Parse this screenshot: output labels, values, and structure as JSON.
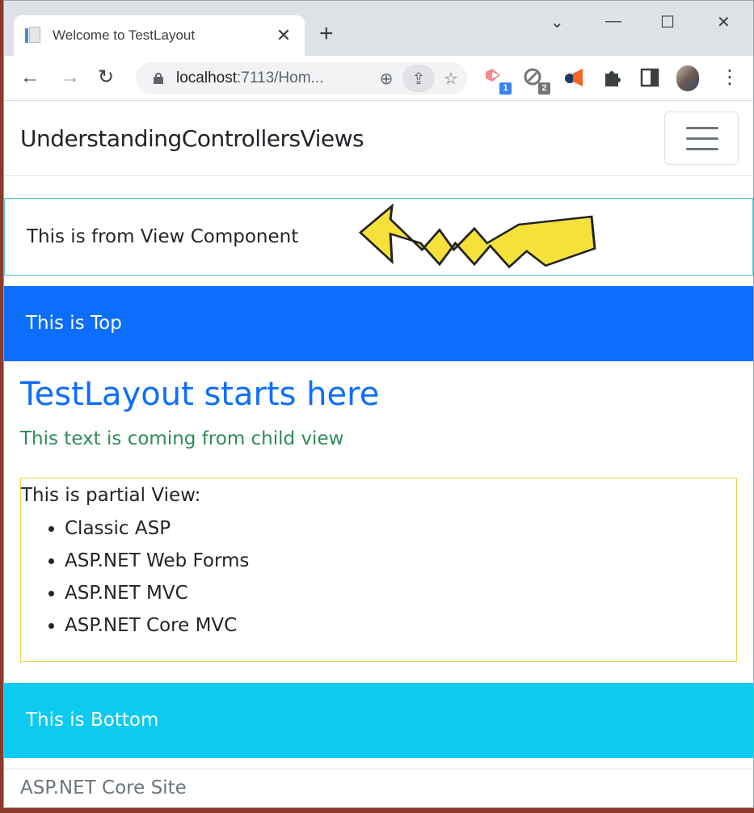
{
  "browser": {
    "tab": {
      "title": "Welcome to TestLayout",
      "close_glyph": "✕",
      "favicon": "document-icon"
    },
    "new_tab_glyph": "+",
    "window_controls": {
      "tab_search": "⌄",
      "minimize": "—",
      "maximize": "☐",
      "close": "✕"
    },
    "nav": {
      "back": "←",
      "forward": "→",
      "reload": "↻"
    },
    "address": {
      "host": "localhost",
      "rest": ":7113/Hom..."
    },
    "omnibox_icons": {
      "zoom": "⊕",
      "share": "⇪",
      "bookmark": "☆"
    },
    "extensions": [
      {
        "name": "extension-1",
        "badge": "1",
        "badge_color": "#3b82f6"
      },
      {
        "name": "extension-2",
        "badge": "2",
        "badge_color": "#757575"
      },
      {
        "name": "extension-3"
      },
      {
        "name": "extensions-puzzle"
      }
    ],
    "menu_glyph": "⋮"
  },
  "page": {
    "brand": "UnderstandingControllersViews",
    "view_component_text": "This is from View Component",
    "top_text": "This is Top",
    "heading": "TestLayout starts here",
    "child_text": "This text is coming from child view",
    "partial": {
      "title": "This is partial View:",
      "items": [
        "Classic ASP",
        "ASP.NET Web Forms",
        "ASP.NET MVC",
        "ASP.NET Core MVC"
      ]
    },
    "bottom_text": "This is Bottom",
    "footer_text": "ASP.NET Core Site"
  },
  "colors": {
    "primary": "#0d6efd",
    "info": "#0dcaf0",
    "success_text": "#2e8b57",
    "view_component_border": "#4dc9da",
    "partial_border": "#f3d34a",
    "arrow_fill": "#f5e13a"
  }
}
